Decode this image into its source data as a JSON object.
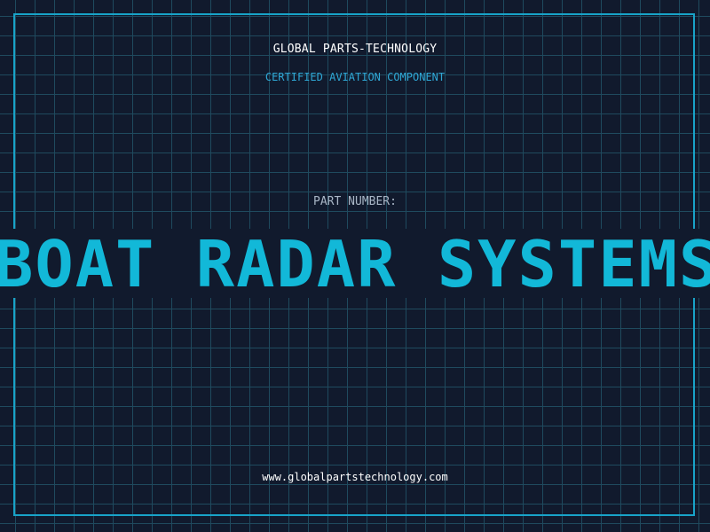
{
  "header": {
    "company": "GLOBAL PARTS-TECHNOLOGY",
    "subtitle": "CERTIFIED AVIATION COMPONENT"
  },
  "part": {
    "label": "PART NUMBER:",
    "title": "BOAT RADAR SYSTEMS"
  },
  "footer": {
    "website": "www.globalpartstechnology.com"
  },
  "colors": {
    "background": "#111a2d",
    "grid": "#1f4a5e",
    "accent": "#12b8d8",
    "frame": "#18a3c8"
  }
}
